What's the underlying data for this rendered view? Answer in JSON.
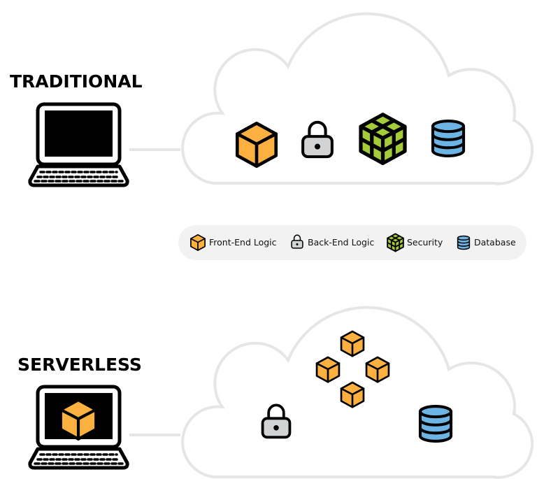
{
  "sections": [
    {
      "title": "TRADITIONAL"
    },
    {
      "title": "SERVERLESS"
    }
  ],
  "legend": [
    {
      "icon": "cube-icon",
      "label": "Front-End Logic"
    },
    {
      "icon": "lock-icon",
      "label": "Back-End Logic"
    },
    {
      "icon": "rubik-cube-icon",
      "label": "Security"
    },
    {
      "icon": "database-icon",
      "label": "Database"
    }
  ],
  "colors": {
    "front_end": "#fbb040",
    "back_end": "#d1d3d4",
    "security": "#a4cc39",
    "database": "#6cb4e4",
    "cloud_outline": "#e6e6e6",
    "legend_bg": "#f2f2f2"
  }
}
